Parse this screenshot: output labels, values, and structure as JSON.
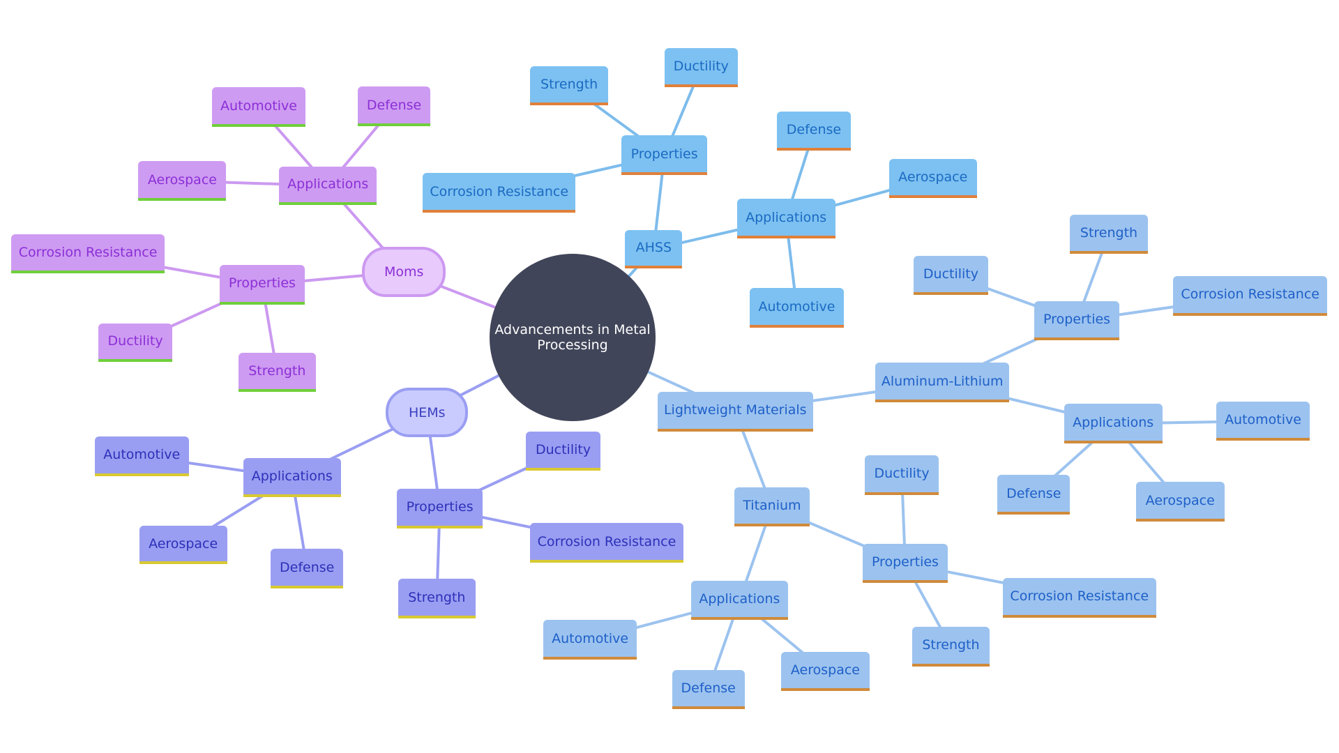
{
  "title": "Advancements in Metal Processing",
  "colors": {
    "root": "#414559",
    "moms_edge": "#cc99f0",
    "hems_edge": "#9a9ef2",
    "ahss_edge": "#7dbcec",
    "light_edge": "#9cc3ef"
  },
  "nodes": {
    "root": "Advancements in Metal Processing",
    "moms": {
      "label": "Moms",
      "applications": {
        "label": "Applications",
        "children": [
          "Automotive",
          "Defense",
          "Aerospace"
        ]
      },
      "properties": {
        "label": "Properties",
        "children": [
          "Corrosion Resistance",
          "Ductility",
          "Strength"
        ]
      }
    },
    "hems": {
      "label": "HEMs",
      "applications": {
        "label": "Applications",
        "children": [
          "Automotive",
          "Aerospace",
          "Defense"
        ]
      },
      "properties": {
        "label": "Properties",
        "children": [
          "Ductility",
          "Corrosion Resistance",
          "Strength"
        ]
      }
    },
    "ahss": {
      "label": "AHSS",
      "properties": {
        "label": "Properties",
        "children": [
          "Strength",
          "Ductility",
          "Corrosion Resistance"
        ]
      },
      "applications": {
        "label": "Applications",
        "children": [
          "Defense",
          "Aerospace",
          "Automotive"
        ]
      }
    },
    "lightweight": {
      "label": "Lightweight Materials",
      "aluminum_lithium": {
        "label": "Aluminum-Lithium",
        "properties": {
          "label": "Properties",
          "children": [
            "Strength",
            "Ductility",
            "Corrosion Resistance"
          ]
        },
        "applications": {
          "label": "Applications",
          "children": [
            "Automotive",
            "Defense",
            "Aerospace"
          ]
        }
      },
      "titanium": {
        "label": "Titanium",
        "properties": {
          "label": "Properties",
          "children": [
            "Ductility",
            "Corrosion Resistance",
            "Strength"
          ]
        },
        "applications": {
          "label": "Applications",
          "children": [
            "Automotive",
            "Defense",
            "Aerospace"
          ]
        }
      }
    }
  }
}
